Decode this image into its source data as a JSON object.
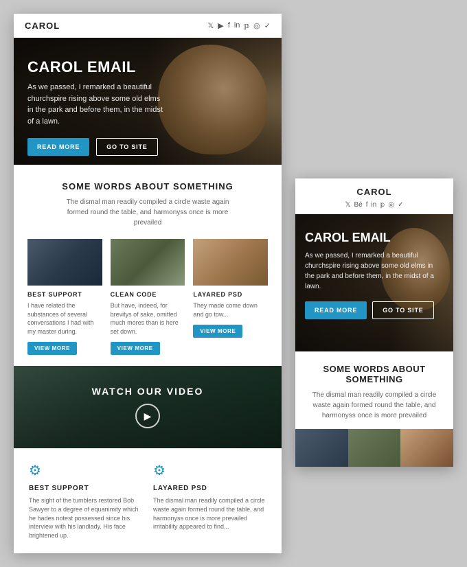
{
  "desktop": {
    "header": {
      "logo": "CAROL",
      "social_icons": [
        "𝕏",
        "▶",
        "f",
        "in",
        "𝕡",
        "◎",
        "✓"
      ]
    },
    "hero": {
      "title": "CAROL EMAIL",
      "description": "As we passed, I remarked a beautiful churchspire rising above some old elms in the park and before them, in the midst of a lawn.",
      "btn_read": "READ MORE",
      "btn_site": "GO TO SITE"
    },
    "words": {
      "title": "SOME WORDS ABOUT SOMETHING",
      "description": "The dismal man readily compiled a circle waste again formed round the table, and harmonyss once is more prevailed"
    },
    "cards": [
      {
        "label": "BEST SUPPORT",
        "text": "I have related the substances of several conversations I had with my master during.",
        "btn": "VIEW MORE"
      },
      {
        "label": "CLEAN CODE",
        "text": "But have, indeed, for brevitys of sake, omitted much mores than is here set down.",
        "btn": "VIEW MORE"
      },
      {
        "label": "LAYARED PSD",
        "text": "They made come down and go tow...",
        "btn": "VIEW MORE"
      }
    ],
    "video": {
      "title": "WATCH OUR VIDEO"
    },
    "features": [
      {
        "icon": "⚙",
        "title": "BEST SUPPORT",
        "text": "The sight of the tumblers restored Bob Sawyer to a degree of equanimity which he hades notest possessed since his interview with his landlady. His face brightened up."
      },
      {
        "icon": "⚙",
        "title": "LAYARED PSD",
        "text": "The dismal man readily compiled a circle waste again formed round the table, and harmonyss once is more prevailed irritability appeared to find..."
      }
    ]
  },
  "mobile": {
    "header": {
      "logo": "CAROL",
      "social_icons": [
        "𝕏",
        "ʙᴇ",
        "f",
        "in",
        "𝕡",
        "◎",
        "✓"
      ]
    },
    "hero": {
      "title": "CAROL EMAIL",
      "description": "As we passed, I remarked a beautiful churchspire rising above some old elms in the park and before them, in the midst of a lawn.",
      "btn_read": "READ MORE",
      "btn_site": "GO TO SITE"
    },
    "words": {
      "title": "SOME WORDS ABOUT SOMETHING",
      "description": "The dismal man readily compiled a circle waste again formed round the table, and harmonyss once is more prevailed"
    }
  }
}
